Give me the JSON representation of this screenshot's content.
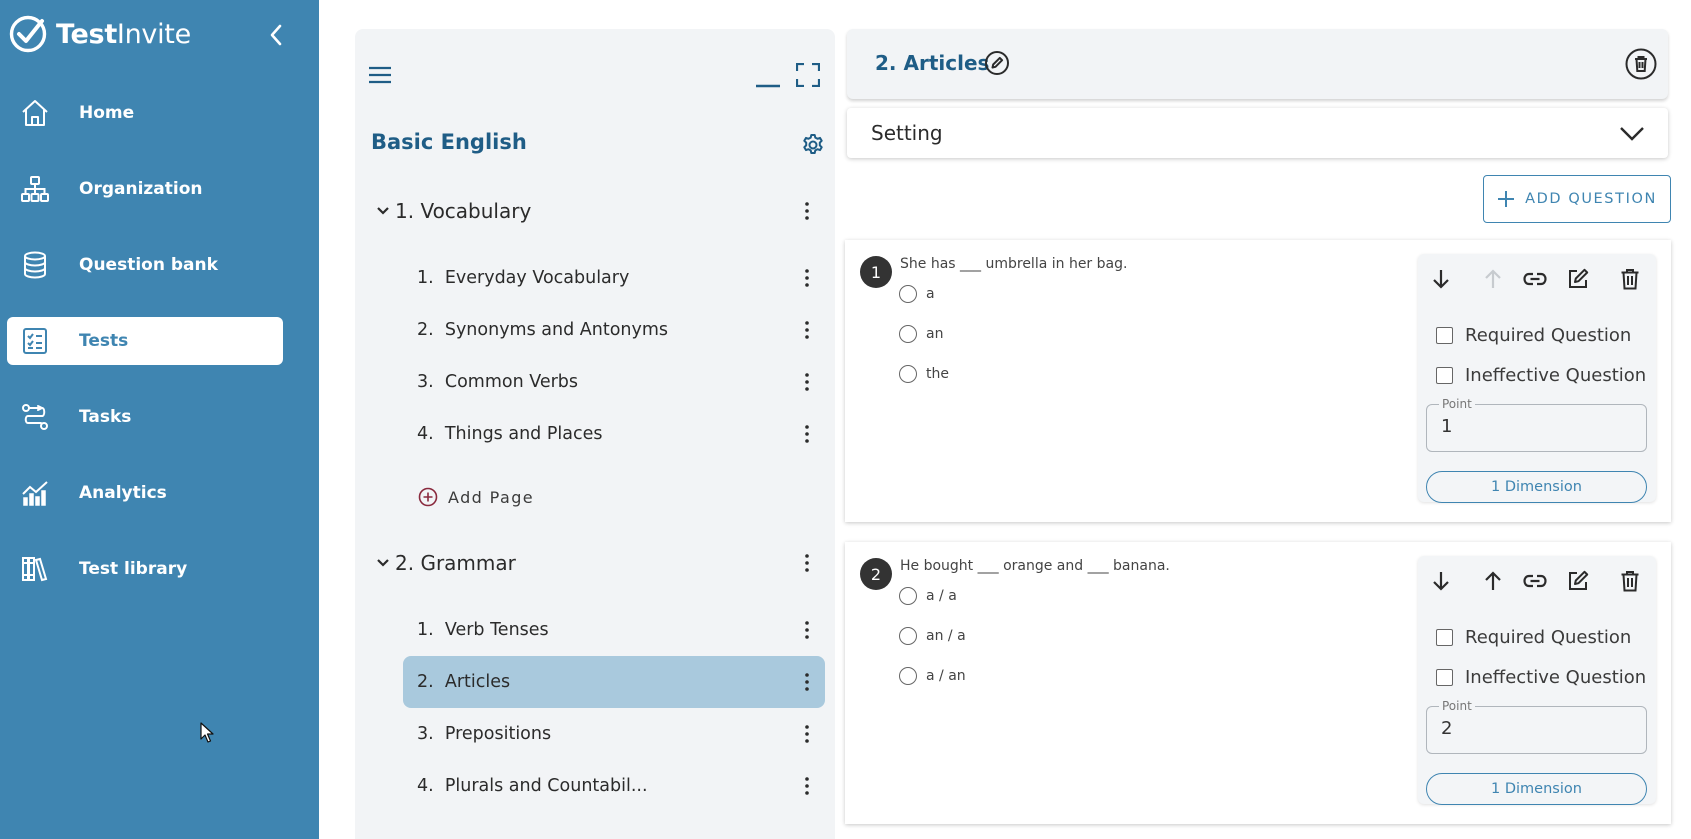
{
  "app": {
    "brand_bold": "Test",
    "brand_regular": "Invite"
  },
  "sidebar": {
    "items": [
      {
        "label": "Home",
        "icon": "home-icon",
        "active": false
      },
      {
        "label": "Organization",
        "icon": "organization-icon",
        "active": false
      },
      {
        "label": "Question bank",
        "icon": "database-icon",
        "active": false
      },
      {
        "label": "Tests",
        "icon": "tests-icon",
        "active": true
      },
      {
        "label": "Tasks",
        "icon": "tasks-icon",
        "active": false
      },
      {
        "label": "Analytics",
        "icon": "analytics-icon",
        "active": false
      },
      {
        "label": "Test library",
        "icon": "library-icon",
        "active": false
      }
    ]
  },
  "outline": {
    "title": "Basic English",
    "sections": [
      {
        "label": "1. Vocabulary",
        "pages": [
          {
            "num": "1.",
            "label": "Everyday Vocabulary"
          },
          {
            "num": "2.",
            "label": "Synonyms and Antonyms"
          },
          {
            "num": "3.",
            "label": "Common Verbs"
          },
          {
            "num": "4.",
            "label": "Things and Places"
          }
        ],
        "add_page_label": "Add Page"
      },
      {
        "label": "2. Grammar",
        "pages": [
          {
            "num": "1.",
            "label": "Verb Tenses"
          },
          {
            "num": "2.",
            "label": "Articles",
            "active": true
          },
          {
            "num": "3.",
            "label": "Prepositions"
          },
          {
            "num": "4.",
            "label": "Plurals and Countabil..."
          }
        ]
      }
    ]
  },
  "page": {
    "title": "2. Articles",
    "setting_label": "Setting",
    "add_question_label": "ADD QUESTION"
  },
  "questions": [
    {
      "number": "1",
      "text": "She has ___ umbrella in her bag.",
      "options": [
        "a",
        "an",
        "the"
      ],
      "required_label": "Required Question",
      "ineffective_label": "Ineffective Question",
      "point_label": "Point",
      "point_value": "1",
      "dimension_label": "1 Dimension",
      "move_up_disabled": true
    },
    {
      "number": "2",
      "text": "He bought ___ orange and ___ banana.",
      "options": [
        "a / a",
        "an / a",
        "a / an"
      ],
      "required_label": "Required Question",
      "ineffective_label": "Ineffective Question",
      "point_label": "Point",
      "point_value": "2",
      "dimension_label": "1 Dimension",
      "move_up_disabled": false
    }
  ],
  "colors": {
    "sidebar": "#3f85b1",
    "accent": "#1f5d86",
    "active_page": "#a9c9dd"
  }
}
